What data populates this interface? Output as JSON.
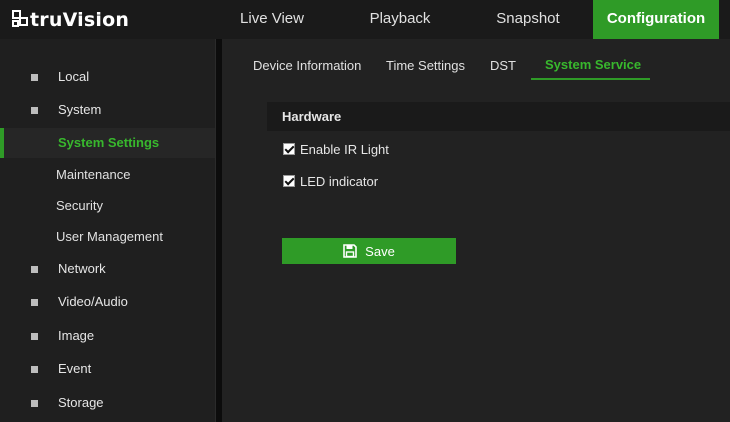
{
  "brand": {
    "name": "truVision"
  },
  "topnav": [
    {
      "label": "Live View"
    },
    {
      "label": "Playback"
    },
    {
      "label": "Snapshot"
    },
    {
      "label": "Configuration",
      "active": true
    }
  ],
  "sidebar": {
    "items": [
      {
        "label": "Local",
        "icon": "square-bullet-icon"
      },
      {
        "label": "System",
        "icon": "square-bullet-icon"
      },
      {
        "label": "System Settings",
        "active": true
      },
      {
        "label": "Maintenance"
      },
      {
        "label": "Security"
      },
      {
        "label": "User Management"
      },
      {
        "label": "Network",
        "icon": "square-bullet-icon"
      },
      {
        "label": "Video/Audio",
        "icon": "square-bullet-icon"
      },
      {
        "label": "Image",
        "icon": "square-bullet-icon"
      },
      {
        "label": "Event",
        "icon": "square-bullet-icon"
      },
      {
        "label": "Storage",
        "icon": "square-bullet-icon"
      }
    ]
  },
  "subtabs": [
    {
      "label": "Device Information"
    },
    {
      "label": "Time Settings"
    },
    {
      "label": "DST"
    },
    {
      "label": "System Service",
      "active": true
    }
  ],
  "hardware": {
    "title": "Hardware",
    "options": [
      {
        "label": "Enable IR Light",
        "checked": true
      },
      {
        "label": "LED indicator",
        "checked": true
      }
    ]
  },
  "save_button": {
    "label": "Save",
    "icon": "floppy-disk-icon"
  },
  "colors": {
    "accent": "#2f9b27",
    "accent_text": "#38b82d",
    "background": "#222222",
    "sidebar": "#1f1f1f"
  }
}
